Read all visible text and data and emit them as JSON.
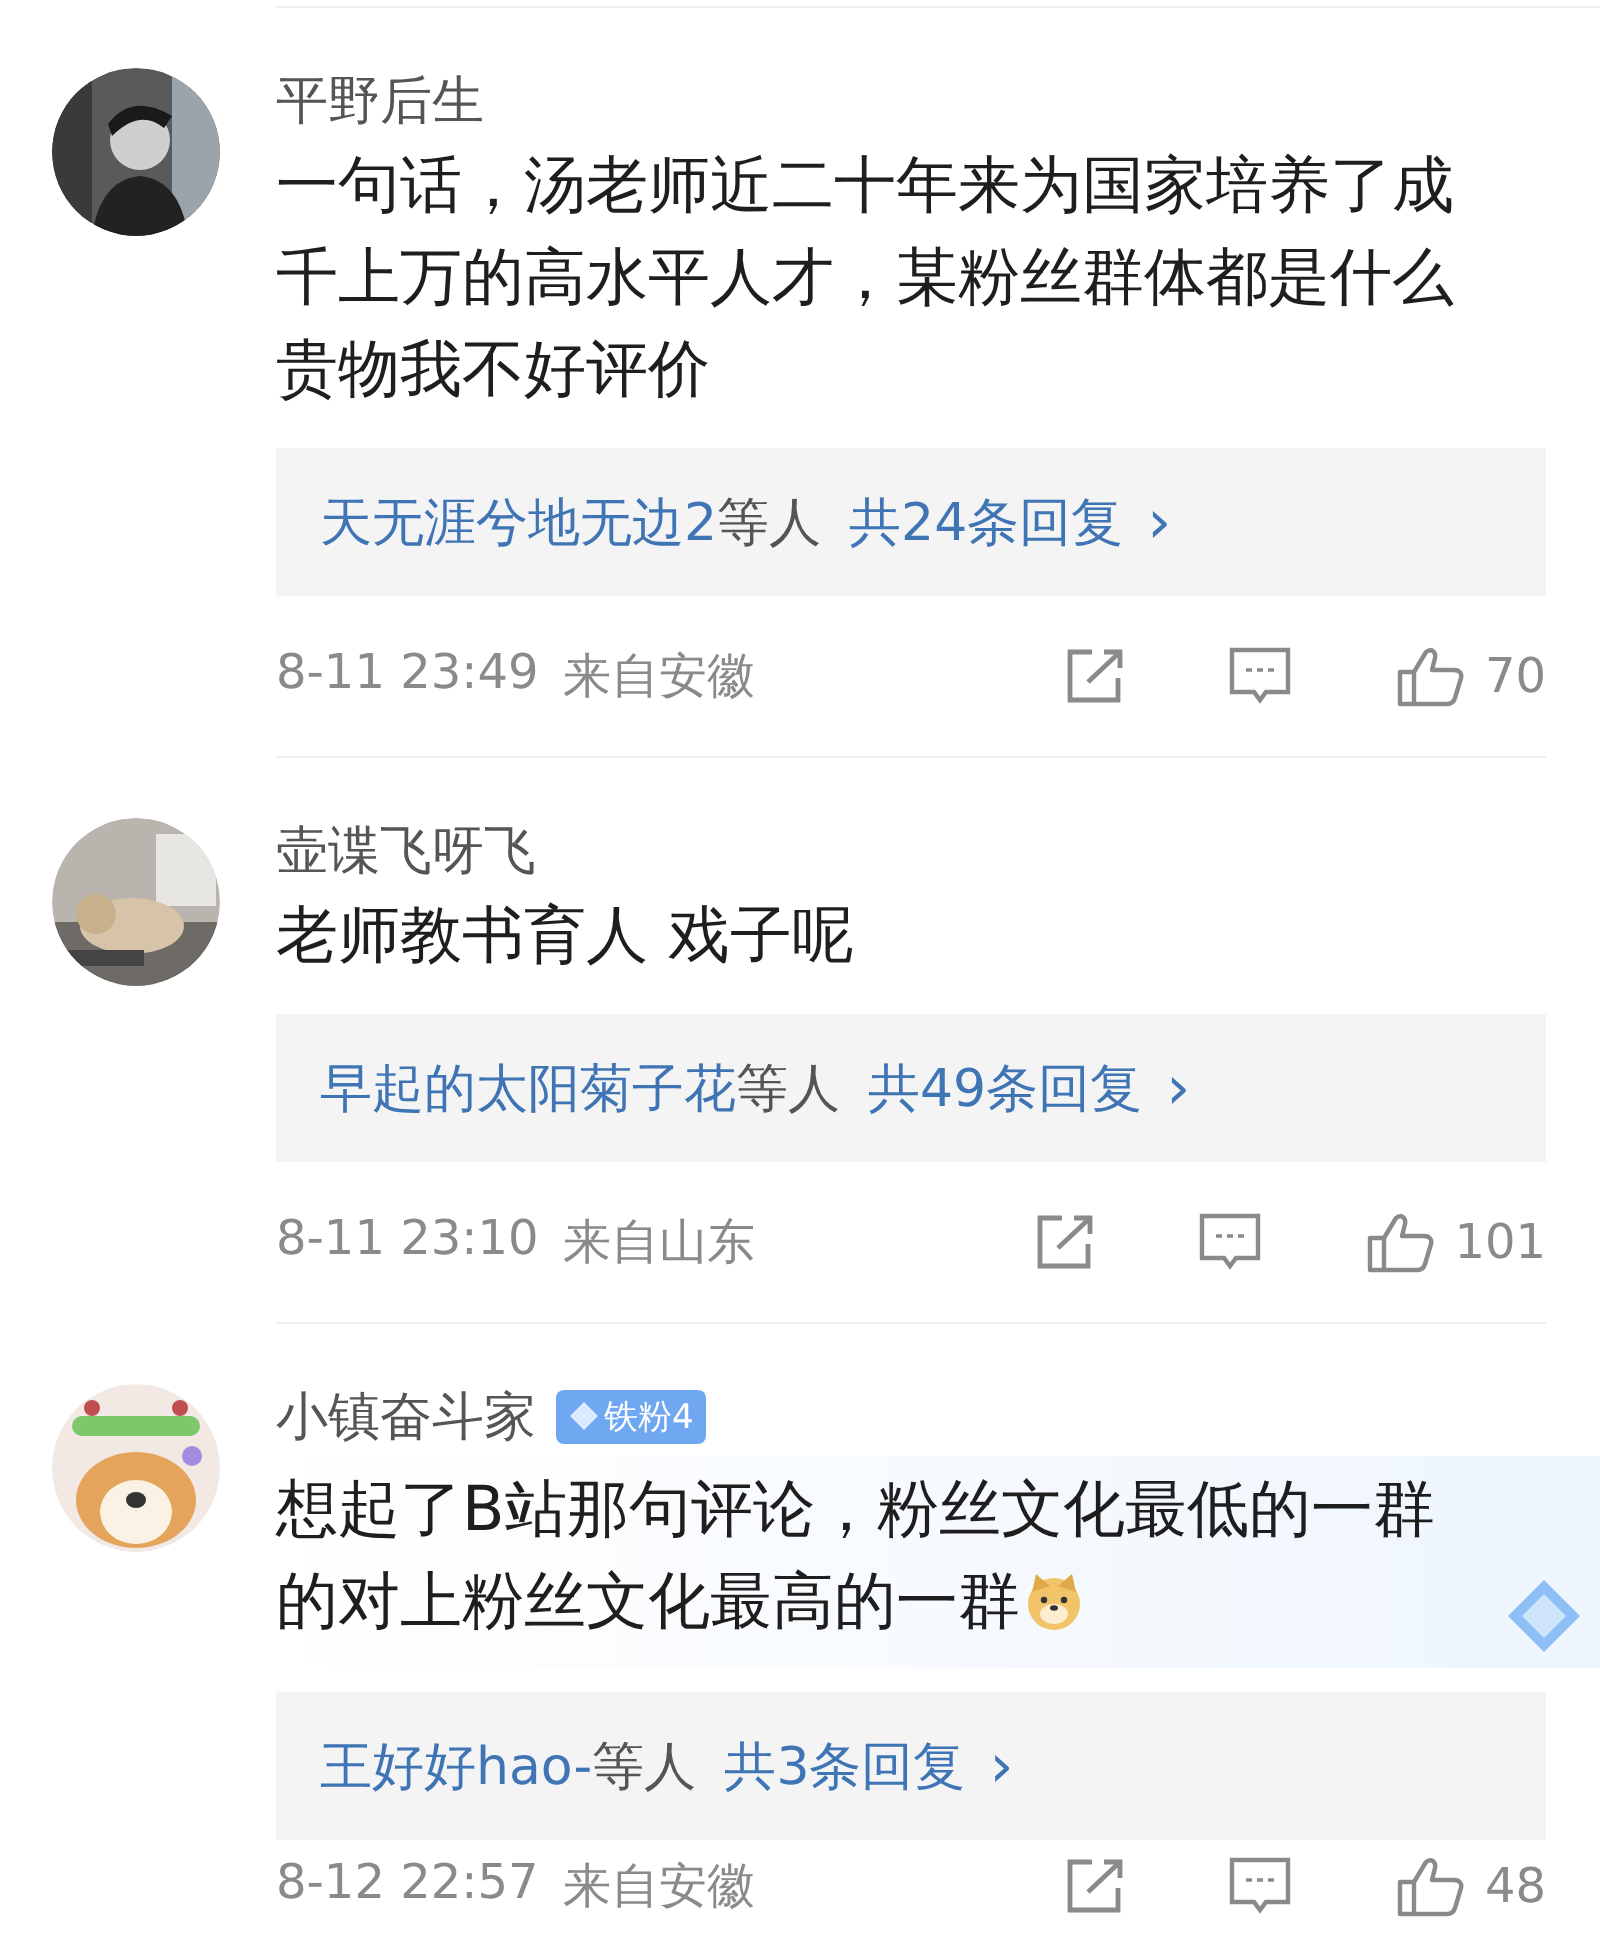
{
  "comments": [
    {
      "name": "平野后生",
      "text": "一句话，汤老师近二十年来为国家培养了成千上万的高水平人才，某粉丝群体都是什么贵物我不好评价",
      "highlighted": false,
      "replies": {
        "users": "天无涯兮地无边2",
        "suffix": "等人",
        "count": "共24条回复",
        "chevron": "›"
      },
      "time": "8-11 23:49",
      "location": "来自安徽",
      "likes": "70"
    },
    {
      "name": "壶谍飞呀飞",
      "text": "老师教书育人 戏子呢",
      "highlighted": false,
      "replies": {
        "users": "早起的太阳菊子花",
        "suffix": "等人",
        "count": "共49条回复",
        "chevron": "›"
      },
      "time": "8-11 23:10",
      "location": "来自山东",
      "likes": "101"
    },
    {
      "name": "小镇奋斗家",
      "badge": "铁粉4",
      "text": "想起了B站那句评论，粉丝文化最低的一群的对上粉丝文化最高的一群",
      "highlighted": true,
      "has_emoji": true,
      "replies": {
        "users": "王好好hao-",
        "suffix": "等人",
        "count": "共3条回复",
        "chevron": "›"
      },
      "time": "8-12 22:57",
      "location": "来自安徽",
      "likes": "48"
    }
  ]
}
